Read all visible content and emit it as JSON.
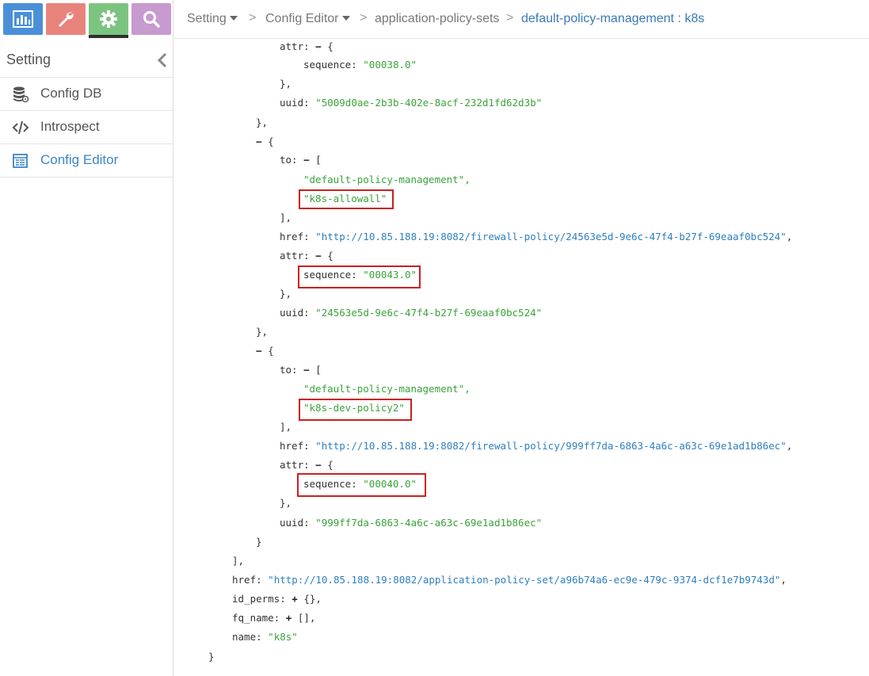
{
  "nav": {
    "buttons": [
      {
        "name": "monitor",
        "icon": "bar-chart-icon",
        "color": "#4a90d9"
      },
      {
        "name": "configure",
        "icon": "wrench-icon",
        "color": "#e8837c"
      },
      {
        "name": "settings",
        "icon": "gear-icon",
        "color": "#7bc47f"
      },
      {
        "name": "query",
        "icon": "search-icon",
        "color": "#c79ad0"
      }
    ]
  },
  "sidebar": {
    "title": "Setting",
    "items": [
      {
        "label": "Config DB",
        "icon": "database-icon"
      },
      {
        "label": "Introspect",
        "icon": "code-icon"
      },
      {
        "label": "Config Editor",
        "icon": "editor-icon",
        "active": true
      }
    ]
  },
  "breadcrumb": {
    "items": [
      "Setting",
      "Config Editor",
      "application-policy-sets",
      "default-policy-management : k8s"
    ],
    "separator": ">"
  },
  "code": {
    "l01_key": "attr:",
    "l01_tog": "−",
    "l01_rest": "{",
    "l02_key": "sequence:",
    "l02_val": "\"00038.0\"",
    "l03": "},",
    "l04_key": "uuid:",
    "l04_val": "\"5009d0ae-2b3b-402e-8acf-232d1fd62d3b\"",
    "l05": "},",
    "l06_tog": "−",
    "l06_rest": "{",
    "l07_key": "to:",
    "l07_tog": "−",
    "l07_rest": "[",
    "l08_val": "\"default-policy-management\",",
    "l09_val": "\"k8s-allowall\"",
    "l10": "],",
    "l11_key": "href:",
    "l11_val": "\"http://10.85.188.19:8082/firewall-policy/24563e5d-9e6c-47f4-b27f-69eaaf0bc524\"",
    "l11_end": ",",
    "l12_key": "attr:",
    "l12_tog": "−",
    "l12_rest": "{",
    "l13_key": "sequence:",
    "l13_val": "\"00043.0\"",
    "l14": "},",
    "l15_key": "uuid:",
    "l15_val": "\"24563e5d-9e6c-47f4-b27f-69eaaf0bc524\"",
    "l16": "},",
    "l17_tog": "−",
    "l17_rest": "{",
    "l18_key": "to:",
    "l18_tog": "−",
    "l18_rest": "[",
    "l19_val": "\"default-policy-management\",",
    "l20_val": "\"k8s-dev-policy2\"",
    "l21": "],",
    "l22_key": "href:",
    "l22_val": "\"http://10.85.188.19:8082/firewall-policy/999ff7da-6863-4a6c-a63c-69e1ad1b86ec\"",
    "l22_end": ",",
    "l23_key": "attr:",
    "l23_tog": "−",
    "l23_rest": "{",
    "l24_key": "sequence:",
    "l24_val": "\"00040.0\"",
    "l25": "},",
    "l26_key": "uuid:",
    "l26_val": "\"999ff7da-6863-4a6c-a63c-69e1ad1b86ec\"",
    "l27": "}",
    "l28": "],",
    "l29_key": "href:",
    "l29_val": "\"http://10.85.188.19:8082/application-policy-set/a96b74a6-ec9e-479c-9374-dcf1e7b9743d\"",
    "l29_end": ",",
    "l30_key": "id_perms:",
    "l30_tog": "+",
    "l30_rest": "{},",
    "l31_key": "fq_name:",
    "l31_tog": "+",
    "l31_rest": "[],",
    "l32_key": "name:",
    "l32_val": "\"k8s\"",
    "l33": "}"
  },
  "colors": {
    "string": "#3aa33a",
    "url": "#2e7fc0",
    "highlight": "#cc1f1f",
    "active_link": "#3a85c6"
  }
}
